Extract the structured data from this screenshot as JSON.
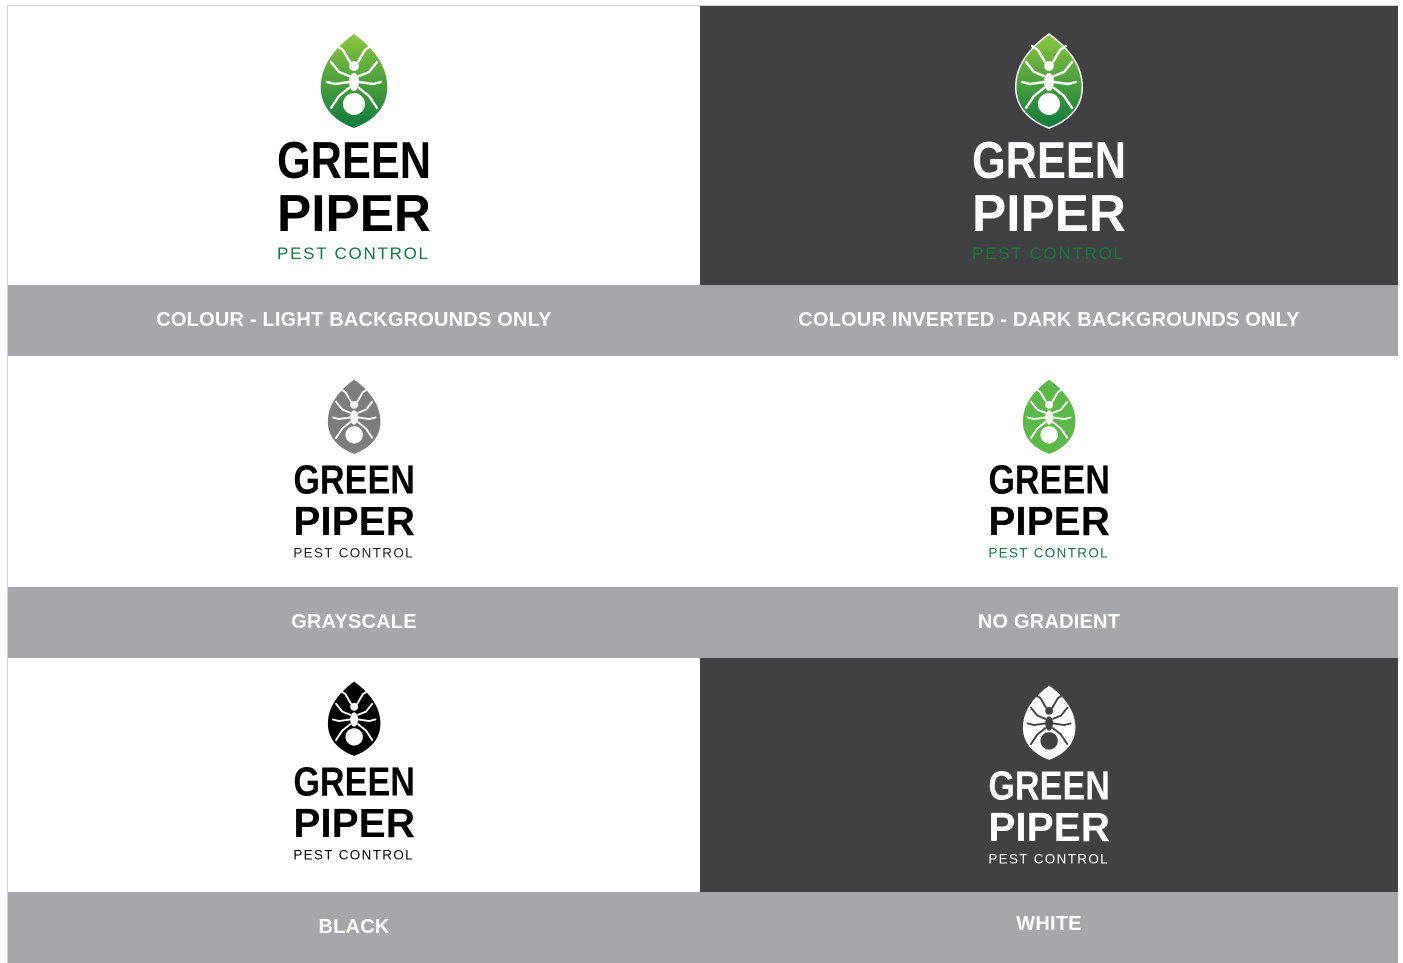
{
  "variants": [
    {
      "id": "colour",
      "label": "COLOUR - LIGHT BACKGROUNDS ONLY",
      "background": "#ffffff",
      "leaf_fill": "gradient-green",
      "ant_fill": "#ffffff",
      "wordmark_color": "#000000",
      "tagline_color": "#0f7a3e",
      "wordmark_line1": "GREEN",
      "wordmark_line2": "PIPER",
      "tagline": "PEST CONTROL"
    },
    {
      "id": "colour-inverted",
      "label": "COLOUR INVERTED - DARK BACKGROUNDS ONLY",
      "background": "#414042",
      "leaf_fill": "gradient-green",
      "ant_fill": "#ffffff",
      "wordmark_color": "#ffffff",
      "tagline_color": "#0f7a3e",
      "wordmark_line1": "GREEN",
      "wordmark_line2": "PIPER",
      "tagline": "PEST CONTROL"
    },
    {
      "id": "grayscale",
      "label": "GRAYSCALE",
      "background": "#ffffff",
      "leaf_fill": "#7d7d7d",
      "ant_fill": "#ffffff",
      "wordmark_color": "#000000",
      "tagline_color": "#231f20",
      "wordmark_line1": "GREEN",
      "wordmark_line2": "PIPER",
      "tagline": "PEST CONTROL"
    },
    {
      "id": "no-gradient",
      "label": "NO GRADIENT",
      "background": "#ffffff",
      "leaf_fill": "#5cb848",
      "ant_fill": "#ffffff",
      "wordmark_color": "#000000",
      "tagline_color": "#0f7a3e",
      "wordmark_line1": "GREEN",
      "wordmark_line2": "PIPER",
      "tagline": "PEST CONTROL"
    },
    {
      "id": "black",
      "label": "BLACK",
      "background": "#ffffff",
      "leaf_fill": "#000000",
      "ant_fill": "#ffffff",
      "wordmark_color": "#000000",
      "tagline_color": "#000000",
      "wordmark_line1": "GREEN",
      "wordmark_line2": "PIPER",
      "tagline": "PEST CONTROL"
    },
    {
      "id": "white",
      "label": "WHITE",
      "background": "#414042",
      "leaf_fill": "#ffffff",
      "ant_fill": "#414042",
      "wordmark_color": "#ffffff",
      "tagline_color": "#ffffff",
      "wordmark_line1": "GREEN",
      "wordmark_line2": "PIPER",
      "tagline": "PEST CONTROL"
    }
  ],
  "colors": {
    "label_bar": "#a6a7aa",
    "label_text": "#ffffff",
    "dark_panel": "#414042",
    "gradient_top": "#8dc63f",
    "gradient_bottom": "#0f7a3e"
  }
}
